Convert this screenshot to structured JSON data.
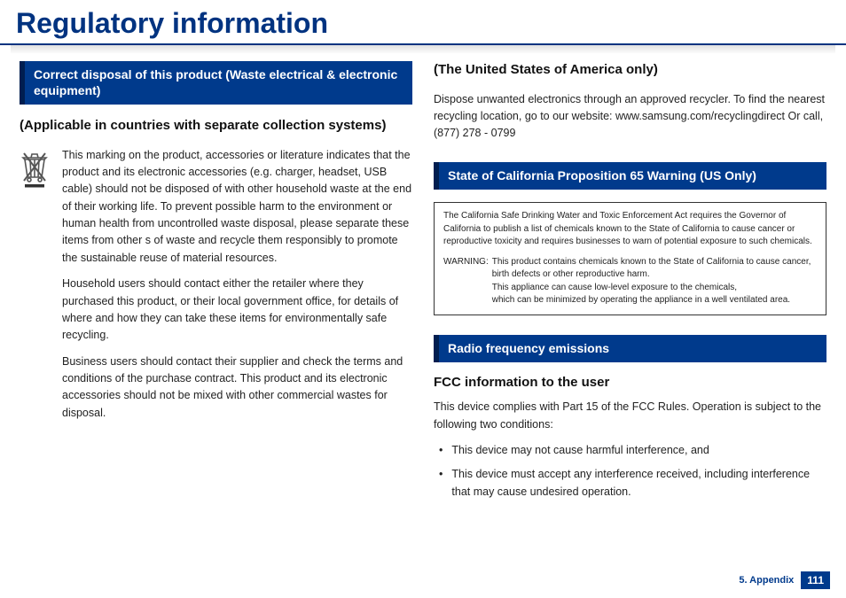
{
  "title": "Regulatory information",
  "left": {
    "header": "Correct disposal of this product (Waste electrical & electronic equipment)",
    "subheading": "(Applicable in countries with separate collection systems)",
    "p1": "This marking on the product, accessories or literature indicates that the product and its electronic accessories (e.g. charger, headset, USB cable) should not be disposed of with other household waste at the end of their working life. To prevent possible harm to the environment or human health from uncontrolled waste disposal, please separate these items from other s of waste and recycle them responsibly to promote the sustainable reuse of material resources.",
    "p2": "Household users should contact either the retailer where they purchased this product, or their local government office, for details of where and how they can take these items for environmentally safe recycling.",
    "p3": "Business users should contact their supplier and check the terms and conditions of the purchase contract. This product and its electronic accessories should not be mixed with other commercial wastes for disposal."
  },
  "right": {
    "usa_heading": "(The United States of America only)",
    "usa_body": "Dispose unwanted electronics through an approved recycler. To find the nearest recycling location, go to our website: www.samsung.com/recyclingdirect Or call, (877) 278 - 0799",
    "prop65_header": "State of California Proposition 65 Warning (US Only)",
    "prop65_intro": "The California Safe Drinking Water and Toxic Enforcement Act requires the Governor of California to publish a list of chemicals known to the State of California to cause cancer or reproductive toxicity and requires businesses to warn of potential exposure to such chemicals.",
    "prop65_warning_label": "WARNING:",
    "prop65_warning_body": "This product contains chemicals known to the State of California to cause cancer, birth defects or other reproductive harm.\nThis appliance can cause low-level exposure to the chemicals,\nwhich can be minimized by operating the appliance in a well ventilated area.",
    "rf_header": "Radio frequency emissions",
    "fcc_heading": "FCC information to the user",
    "fcc_body": "This device complies with Part 15 of the FCC Rules. Operation is subject to the following two conditions:",
    "bullet1": "This device may not cause harmful interference, and",
    "bullet2": "This device must accept any interference received, including interference that may cause undesired operation."
  },
  "footer": {
    "section": "5. Appendix",
    "page": "111"
  }
}
